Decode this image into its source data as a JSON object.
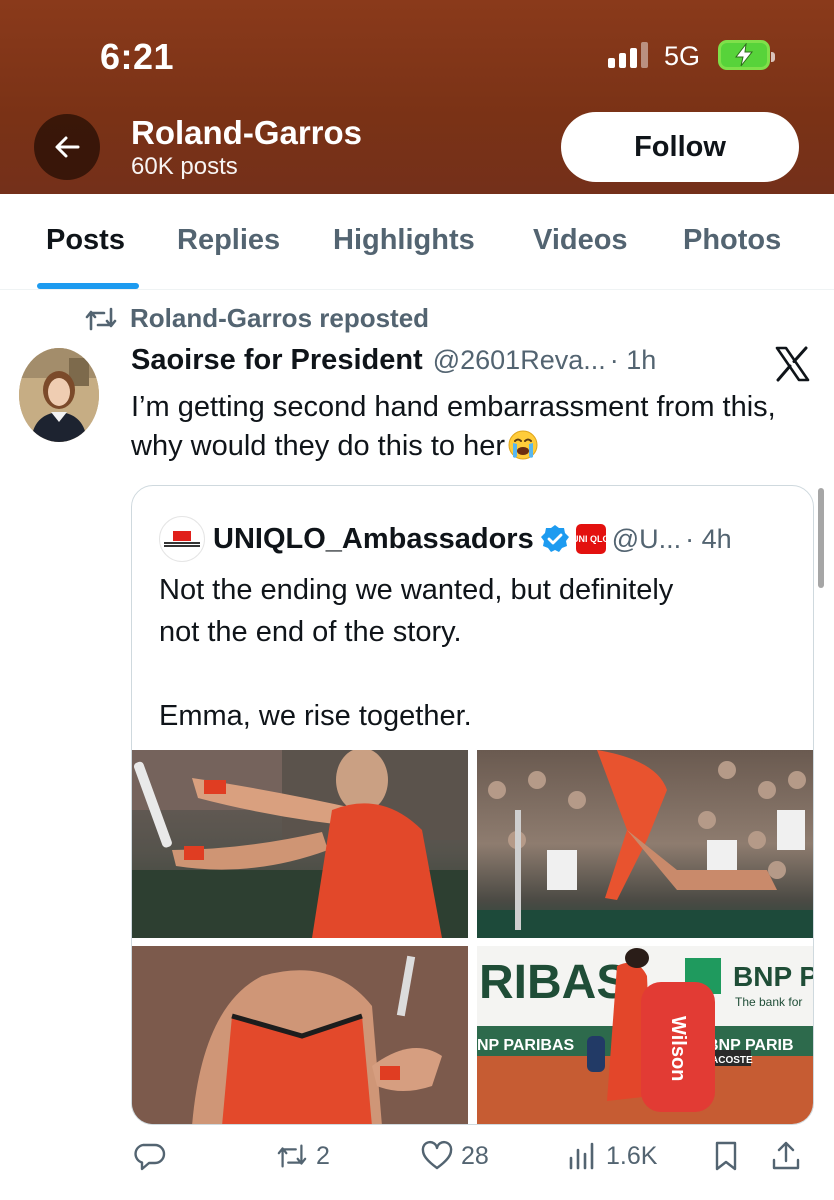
{
  "status_bar": {
    "time": "6:21",
    "network": "5G"
  },
  "header": {
    "profile_name": "Roland-Garros",
    "post_count": "60K posts",
    "follow_label": "Follow"
  },
  "tabs": [
    {
      "label": "Posts",
      "active": true
    },
    {
      "label": "Replies"
    },
    {
      "label": "Highlights"
    },
    {
      "label": "Videos"
    },
    {
      "label": "Photos"
    }
  ],
  "post": {
    "repost_label": "Roland-Garros reposted",
    "author_name": "Saoirse for President",
    "author_handle": "@2601Reva...",
    "time": "· 1h",
    "text": "I’m getting second hand embarrassment from this, why would they do this to her"
  },
  "quote": {
    "avatar_text": "GLOBAL BRAND AMBASSADORS",
    "author_name": "UNIQLO_Ambassadors",
    "badge_text": "UNI QLO",
    "author_handle": "@U...",
    "time": "· 4h",
    "text": "Not the ending we wanted, but definitely\nnot the end of the story.\n\nEmma, we rise together."
  },
  "photo4_signage": {
    "left_board": "RIBAS",
    "sponsor": "BNP P",
    "tagline": "The bank for",
    "lower_left": "NP PARIBAS",
    "lower_right": "BNP PARIB",
    "small_sign": "ACOSTE",
    "bag_brand": "Wilson"
  },
  "actions": {
    "reposts": "2",
    "likes": "28",
    "views": "1.6K"
  },
  "colors": {
    "header_bg": "#7a3216",
    "accent": "#1d9bf0",
    "muted": "#536471"
  }
}
